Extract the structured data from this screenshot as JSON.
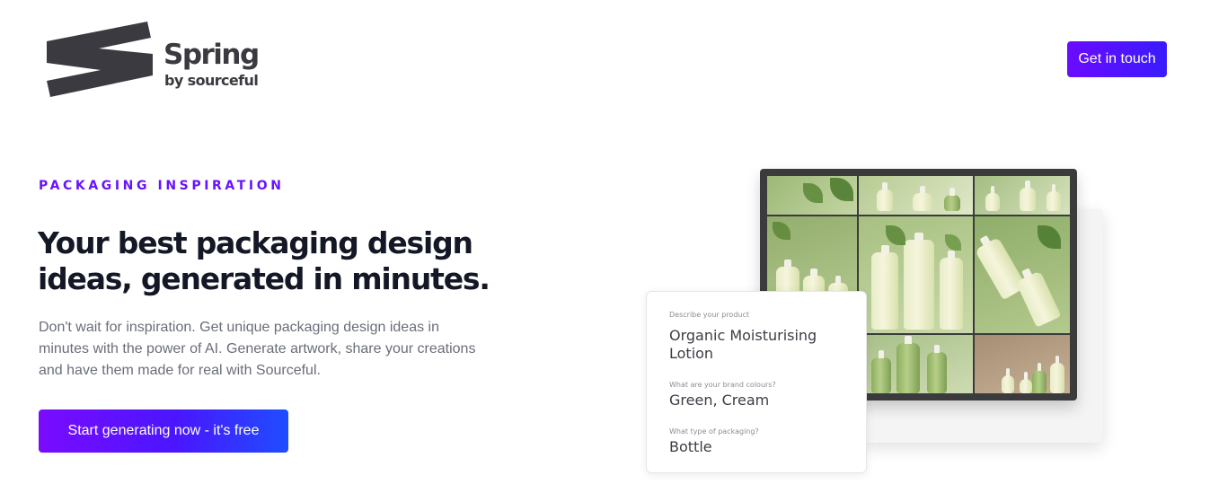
{
  "header": {
    "logo_word": "Spring",
    "logo_sub": "by sourceful",
    "cta_label": "Get in touch"
  },
  "hero": {
    "eyebrow": "PACKAGING INSPIRATION",
    "headline_line1": "Your best packaging design",
    "headline_line2": "ideas, generated in minutes.",
    "lead": "Don't wait for inspiration. Get unique packaging design ideas in minutes with the power of AI. Generate artwork, share your creations and have them made for real with Sourceful.",
    "cta_label": "Start generating now - it's free"
  },
  "form_card": {
    "fields": [
      {
        "label": "Describe your product",
        "value": "Organic Moisturising Lotion"
      },
      {
        "label": "What are your brand colours?",
        "value": "Green, Cream"
      },
      {
        "label": "What type of packaging?",
        "value": "Bottle"
      }
    ]
  },
  "colors": {
    "accent": "#6a12ff",
    "button_gradient_start": "#7a0bff",
    "button_gradient_end": "#1f4dff",
    "heading": "#141826",
    "body_text": "#6a6e78",
    "logo": "#3a3a40"
  }
}
